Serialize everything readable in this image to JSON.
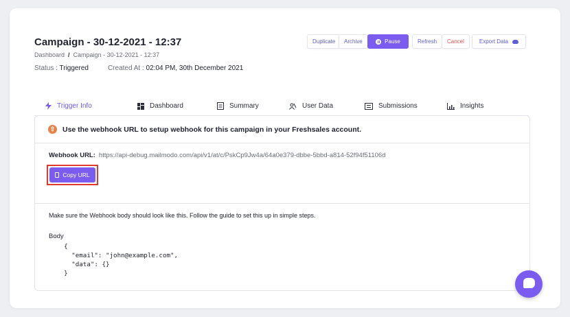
{
  "campaign": {
    "title": "Campaign - 30-12-2021 - 12:37",
    "breadcrumb_home": "Dashboard",
    "breadcrumb_sep": "/",
    "breadcrumb_current": "Campaign - 30-12-2021 - 12:37",
    "status_label": "Status :",
    "status_value": "Triggered",
    "created_label": "Created At :",
    "created_value": "02:04 PM, 30th December 2021"
  },
  "toolbar": {
    "duplicate": "Duplicate",
    "archive": "Archive",
    "pause": "Pause",
    "refresh": "Refresh",
    "cancel": "Cancel",
    "export": "Export Data"
  },
  "tabs": [
    {
      "label": "Trigger Info",
      "icon": "bolt-icon"
    },
    {
      "label": "Dashboard",
      "icon": "dashboard-icon"
    },
    {
      "label": "Summary",
      "icon": "summary-icon"
    },
    {
      "label": "User Data",
      "icon": "user-data-icon"
    },
    {
      "label": "Submissions",
      "icon": "submissions-icon"
    },
    {
      "label": "Insights",
      "icon": "insights-icon"
    }
  ],
  "panel": {
    "heading": "Use the webhook URL to setup webhook for this campaign in your Freshsales account.",
    "webhook_label": "Webhook URL:",
    "webhook_url": "https://api-debug.mailmodo.com/api/v1/at/c/PskCp9Jw4a/64a0e379-dbbe-5bbd-a814-52f94f51106d",
    "copy_button": "Copy URL",
    "instructions": "Make sure the Webhook body should look like this. Follow the guide to set this up in simple steps.",
    "body_label": "Body",
    "body_code": "    {\n      \"email\": \"john@example.com\",\n      \"data\": {}\n    }"
  },
  "colors": {
    "accent": "#7b5cf0",
    "danger": "#e05454",
    "highlight": "#e2392f"
  }
}
